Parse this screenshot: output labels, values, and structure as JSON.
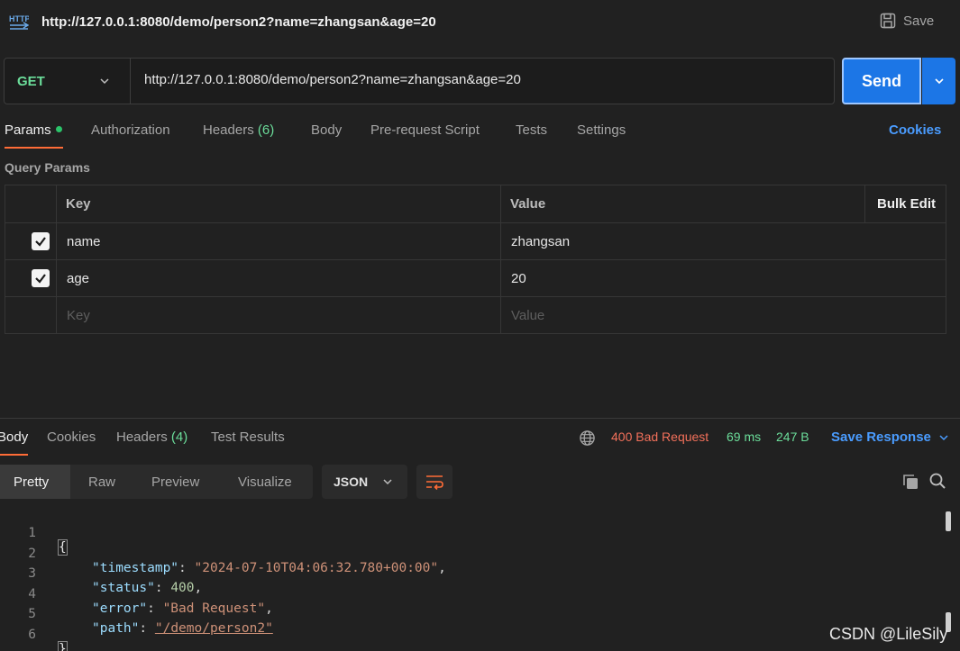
{
  "request": {
    "title": "http://127.0.0.1:8080/demo/person2?name=zhangsan&age=20",
    "save_label": "Save",
    "method": "GET",
    "url": "http://127.0.0.1:8080/demo/person2?name=zhangsan&age=20",
    "send_label": "Send"
  },
  "tabs": {
    "params": "Params",
    "authorization": "Authorization",
    "headers": "Headers",
    "headers_count": "(6)",
    "body": "Body",
    "prerequest": "Pre-request Script",
    "tests": "Tests",
    "settings": "Settings",
    "cookies": "Cookies"
  },
  "query_params": {
    "label": "Query Params",
    "columns": {
      "key": "Key",
      "value": "Value",
      "bulk_edit": "Bulk Edit"
    },
    "rows": [
      {
        "key": "name",
        "value": "zhangsan",
        "checked": true
      },
      {
        "key": "age",
        "value": "20",
        "checked": true
      }
    ],
    "key_placeholder": "Key",
    "value_placeholder": "Value"
  },
  "response": {
    "tabs": {
      "body": "Body",
      "cookies": "Cookies",
      "headers": "Headers",
      "headers_count": "(4)",
      "test_results": "Test Results"
    },
    "status": "400 Bad Request",
    "time": "69 ms",
    "size": "247 B",
    "save_response": "Save Response",
    "views": [
      "Pretty",
      "Raw",
      "Preview",
      "Visualize"
    ],
    "format": "JSON",
    "lines": [
      {
        "num": "1",
        "open": "{"
      },
      {
        "num": "2",
        "key": "\"timestamp\"",
        "value": "\"2024-07-10T04:06:32.780+00:00\"",
        "tail": ","
      },
      {
        "num": "3",
        "key": "\"status\"",
        "value": "400",
        "tail": ","
      },
      {
        "num": "4",
        "key": "\"error\"",
        "value": "\"Bad Request\"",
        "tail": ","
      },
      {
        "num": "5",
        "key": "\"path\"",
        "value": "\"/demo/person2\"",
        "tail": ""
      },
      {
        "num": "6",
        "close": "}"
      }
    ]
  },
  "watermark": "CSDN @LileSily",
  "colors": {
    "accent_orange": "#ff6c37",
    "send_blue": "#1c76e6",
    "link_blue": "#4a9cff",
    "method_green": "#6bdd9a",
    "status_red": "#f2705a"
  }
}
